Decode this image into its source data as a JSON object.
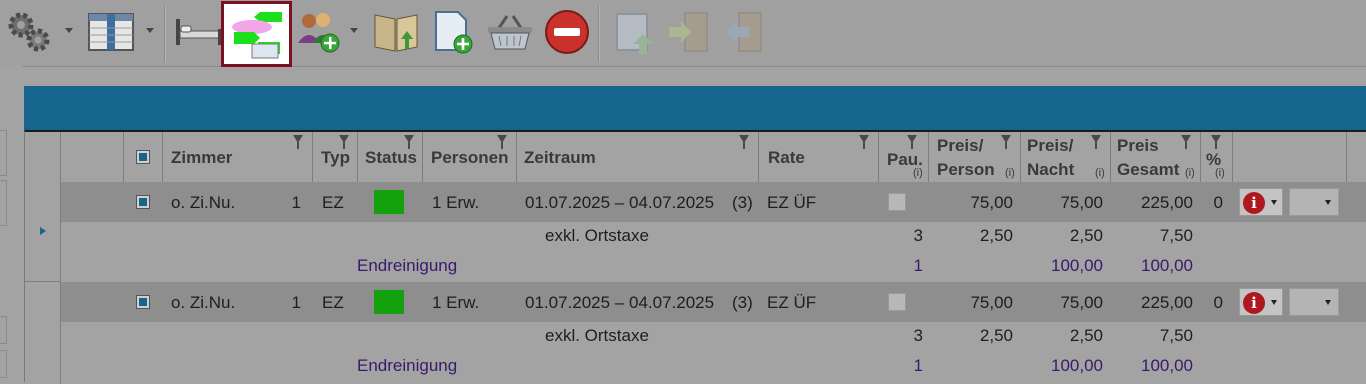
{
  "toolbar": {
    "icons": [
      "gears-icon",
      "columns-icon",
      "bed-icon",
      "room-move-icon",
      "add-guests-icon",
      "open-book-icon",
      "new-document-icon",
      "basket-icon",
      "stop-icon",
      "document-up-icon",
      "door-in-icon",
      "door-out-icon"
    ],
    "selected": "room-move-icon"
  },
  "grid": {
    "columns": {
      "zimmer": "Zimmer",
      "typ": "Typ",
      "status": "Status",
      "personen": "Personen",
      "zeitraum": "Zeitraum",
      "rate": "Rate",
      "pau": "Pau.",
      "preis_person_1": "Preis/",
      "preis_person_2": "Person",
      "preis_nacht_1": "Preis/",
      "preis_nacht_2": "Nacht",
      "preis_gesamt_1": "Preis",
      "preis_gesamt_2": "Gesamt",
      "prozent": "%",
      "info_marker": "(i)"
    },
    "rows": [
      {
        "zimmer": "o. Zi.Nu.",
        "count": "1",
        "typ": "EZ",
        "status_color": "#13a10e",
        "personen": "1 Erw.",
        "zeitraum": "01.07.2025 – 04.07.2025",
        "nights": "(3)",
        "rate": "EZ ÜF",
        "preis_person": "75,00",
        "preis_nacht": "75,00",
        "preis_gesamt": "225,00",
        "prozent": "0",
        "sub": [
          {
            "label": "exkl. Ortstaxe",
            "pau": "3",
            "preis_person": "2,50",
            "preis_nacht": "2,50",
            "preis_gesamt": "7,50"
          },
          {
            "label": "Endreinigung",
            "pau": "1",
            "preis_person": "",
            "preis_nacht": "100,00",
            "preis_gesamt": "100,00"
          }
        ]
      },
      {
        "zimmer": "o. Zi.Nu.",
        "count": "1",
        "typ": "EZ",
        "status_color": "#13a10e",
        "personen": "1 Erw.",
        "zeitraum": "01.07.2025 – 04.07.2025",
        "nights": "(3)",
        "rate": "EZ ÜF",
        "preis_person": "75,00",
        "preis_nacht": "75,00",
        "preis_gesamt": "225,00",
        "prozent": "0",
        "sub": [
          {
            "label": "exkl. Ortstaxe",
            "pau": "3",
            "preis_person": "2,50",
            "preis_nacht": "2,50",
            "preis_gesamt": "7,50"
          },
          {
            "label": "Endreinigung",
            "pau": "1",
            "preis_person": "",
            "preis_nacht": "100,00",
            "preis_gesamt": "100,00"
          }
        ]
      }
    ]
  },
  "colors": {
    "accent": "#16658f",
    "selection_border": "#7a1020",
    "status_ok": "#13a10e",
    "info_red": "#b0181f"
  }
}
